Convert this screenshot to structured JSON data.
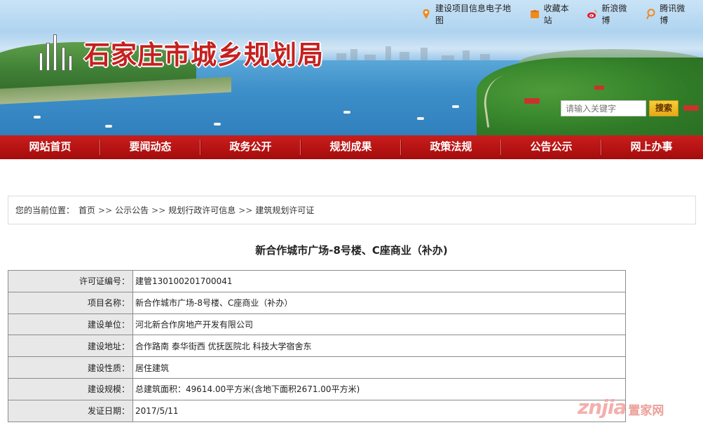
{
  "site": {
    "title": "石家庄市城乡规划局",
    "top_links": [
      {
        "label": "建设项目信息电子地图",
        "icon": "map-pin-icon"
      },
      {
        "label": "收藏本站",
        "icon": "bookmark-icon"
      },
      {
        "label": "新浪微博",
        "icon": "sina-weibo-icon"
      },
      {
        "label": "腾讯微博",
        "icon": "tencent-weibo-icon"
      }
    ],
    "search": {
      "placeholder": "请输入关键字",
      "button": "搜索"
    }
  },
  "nav": {
    "items": [
      {
        "label": "网站首页"
      },
      {
        "label": "要闻动态"
      },
      {
        "label": "政务公开"
      },
      {
        "label": "规划成果"
      },
      {
        "label": "政策法规"
      },
      {
        "label": "公告公示"
      },
      {
        "label": "网上办事"
      }
    ]
  },
  "breadcrumb": {
    "prefix": "您的当前位置：",
    "items": [
      {
        "label": "首页"
      },
      {
        "label": "公示公告"
      },
      {
        "label": "规划行政许可信息"
      },
      {
        "label": "建筑规划许可证"
      }
    ],
    "separator": ">>"
  },
  "main": {
    "title": "新合作城市广场-8号楼、C座商业（补办)",
    "rows": [
      {
        "label": "许可证编号：",
        "value": "建管130100201700041"
      },
      {
        "label": "项目名称：",
        "value": "新合作城市广场-8号楼、C座商业（补办）"
      },
      {
        "label": "建设单位：",
        "value": "河北新合作房地产开发有限公司"
      },
      {
        "label": "建设地址：",
        "value": "合作路南 泰华街西 优抚医院北 科技大学宿舍东"
      },
      {
        "label": "建设性质：",
        "value": "居住建筑"
      },
      {
        "label": "建设规模：",
        "value": "总建筑面积：49614.00平方米(含地下面积2671.00平方米)"
      },
      {
        "label": "发证日期：",
        "value": "2017/5/11"
      }
    ]
  },
  "watermark": {
    "latin": "znjia",
    "cn": "置家网"
  },
  "colors": {
    "nav_red": "#b51212",
    "title_red": "#c5211f",
    "search_button": "#e6a917",
    "label_cell_bg": "#e8e8e8"
  }
}
